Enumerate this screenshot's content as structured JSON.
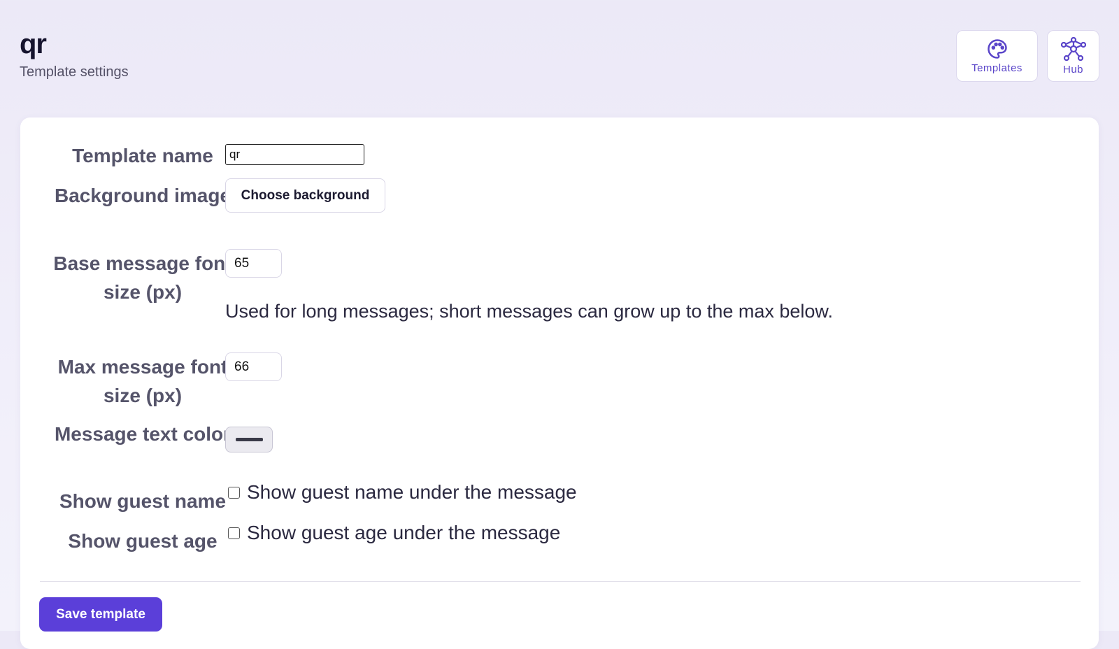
{
  "header": {
    "title": "qr",
    "subtitle": "Template settings"
  },
  "nav": {
    "templates_label": "Templates",
    "hub_label": "Hub"
  },
  "form": {
    "template_name_label": "Template name",
    "template_name_value": "qr",
    "background_label": "Background image",
    "background_button": "Choose background",
    "base_size_label": "Base message font size (px)",
    "base_size_value": "65",
    "base_size_hint": "Used for long messages; short messages can grow up to the max below.",
    "max_size_label": "Max message font size (px)",
    "max_size_value": "66",
    "text_color_label": "Message text color",
    "text_color_value": "#3a3a48",
    "show_name_label": "Show guest name",
    "show_name_text": "Show guest name under the message",
    "show_age_label": "Show guest age",
    "show_age_text": "Show guest age under the message",
    "save_button": "Save template"
  },
  "colors": {
    "accent": "#5b3fd9",
    "background": "#ece9f7"
  }
}
